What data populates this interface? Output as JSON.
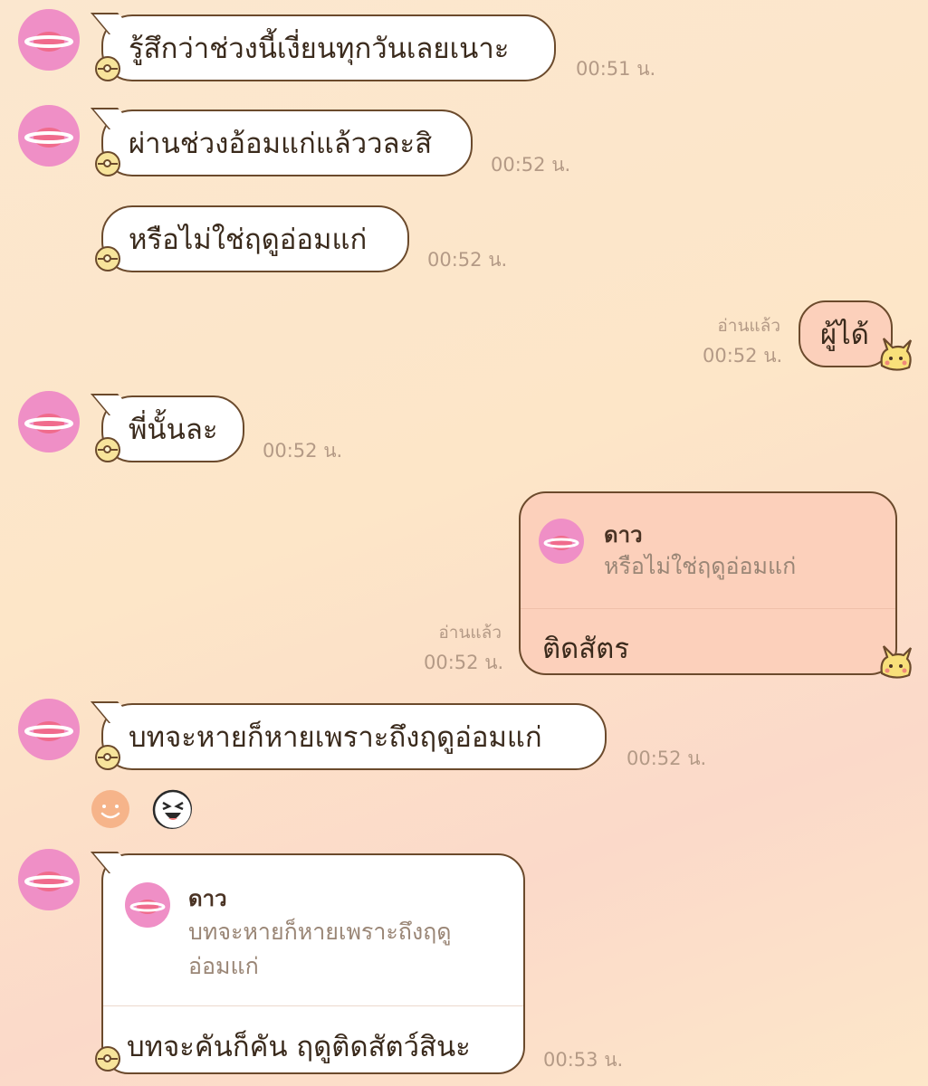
{
  "messages": [
    {
      "text": "รู้สึกว่าช่วงนี้เงี่ยนทุกวันเลยเนาะ",
      "time": "00:51 น."
    },
    {
      "text": "ผ่านช่วงอ้อมแก่แล้ววละสิ",
      "time": "00:52 น."
    },
    {
      "text": "หรือไม่ใช่ฤดูอ่อมแก่",
      "time": "00:52 น."
    },
    {
      "text": "ผู้ได้",
      "time": "00:52 น.",
      "status": "อ่านแล้ว"
    },
    {
      "text": "พี่นั้นละ",
      "time": "00:52 น."
    },
    {
      "reply_name": "ดาว",
      "reply_quote": "หรือไม่ใช่ฤดูอ่อมแก่",
      "text": "ติดสัตร",
      "time": "00:52 น.",
      "status": "อ่านแล้ว"
    },
    {
      "text": "บทจะหายก็หายเพราะถึงฤดูอ่อมแก่",
      "time": "00:52 น."
    },
    {
      "reply_name": "ดาว",
      "reply_quote_line1": "บทจะหายก็หายเพราะถึงฤดู",
      "reply_quote_line2": "อ่อมแก่",
      "text": "บทจะคันก็คัน ฤดูติดสัตว์สินะ",
      "time": "00:53 น."
    }
  ],
  "icons": {
    "avatar": "pink-planet-icon",
    "badge": "pokeball-icon",
    "sticker": "pikachu-icon",
    "reaction_smile": "smile-reaction-icon",
    "reaction_laugh": "laugh-reaction-icon"
  },
  "colors": {
    "incoming_bubble": "#ffffff",
    "outgoing_bubble": "#fcd0bb",
    "avatar": "#ef8fc6",
    "outline": "#6b4a2c"
  }
}
